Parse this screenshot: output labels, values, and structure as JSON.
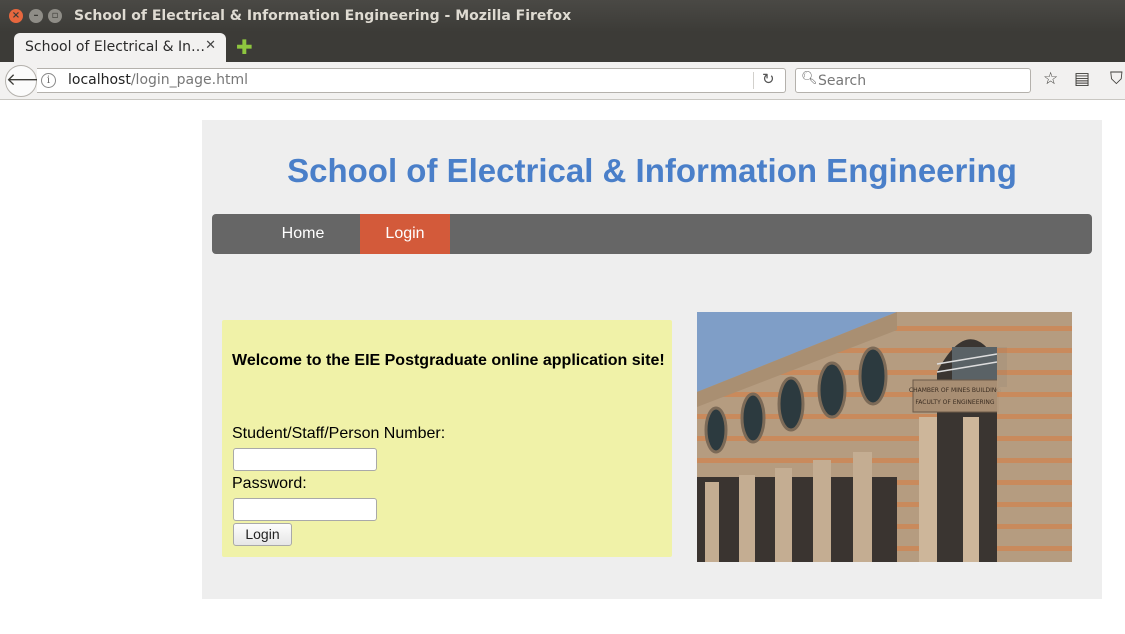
{
  "window": {
    "title": "School of Electrical & Information Engineering - Mozilla Firefox"
  },
  "browser": {
    "tab_label": "School of Electrical & In…",
    "url_host": "localhost",
    "url_path": "/login_page.html",
    "search_placeholder": "Search"
  },
  "page": {
    "title": "School of Electrical & Information Engineering",
    "menu": {
      "home": "Home",
      "login": "Login"
    },
    "login_box": {
      "welcome": "Welcome to the EIE Postgraduate online application site!",
      "user_label": "Student/Staff/Person Number:",
      "password_label": "Password:",
      "button_label": "Login"
    },
    "building_sign": {
      "line1": "CHAMBER OF MINES BUILDING",
      "line2": "FACULTY OF ENGINEERING"
    }
  },
  "colors": {
    "title_blue": "#4a7fc9",
    "menu_bg": "#666666",
    "menu_active": "#d35a3a",
    "login_box_bg": "#f0f2a8",
    "container_bg": "#eeeeee"
  }
}
